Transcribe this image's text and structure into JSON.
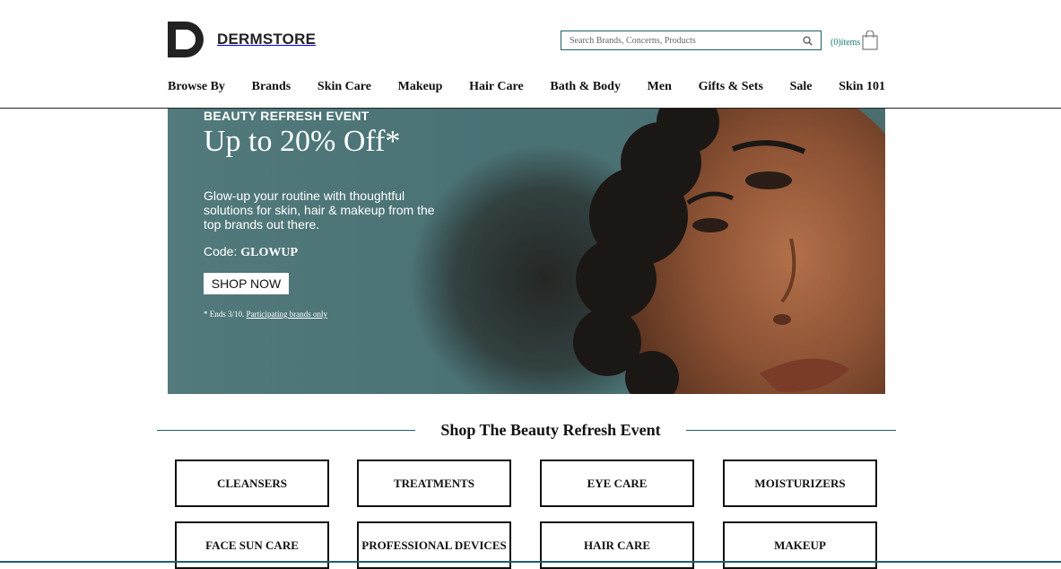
{
  "brand": {
    "name": "DERMSTORE"
  },
  "search": {
    "placeholder": "Search Brands, Concerns, Products",
    "icon": "search-icon"
  },
  "cart": {
    "count_label": "(0)items",
    "icon": "shopping-bag-icon"
  },
  "nav": {
    "items": [
      {
        "label": "Browse By"
      },
      {
        "label": "Brands"
      },
      {
        "label": "Skin Care"
      },
      {
        "label": "Makeup"
      },
      {
        "label": "Hair Care"
      },
      {
        "label": "Bath & Body"
      },
      {
        "label": "Men"
      },
      {
        "label": "Gifts & Sets"
      },
      {
        "label": "Sale"
      },
      {
        "label": "Skin 101"
      }
    ]
  },
  "hero": {
    "eyebrow": "BEAUTY REFRESH EVENT",
    "headline": "Up to 20% Off*",
    "body": "Glow-up your routine with thoughtful solutions for skin, hair & makeup from the top brands out there.",
    "code_label": "Code:",
    "code_value": "GLOWUP",
    "cta": "SHOP NOW",
    "fine_print": "* Ends 3/10.",
    "fine_link": "Participating brands only"
  },
  "section": {
    "title": "Shop The Beauty Refresh Event"
  },
  "categories": [
    {
      "label": "CLEANSERS"
    },
    {
      "label": "TREATMENTS"
    },
    {
      "label": "EYE CARE"
    },
    {
      "label": "MOISTURIZERS"
    },
    {
      "label": "FACE SUN CARE"
    },
    {
      "label": "PROFESSIONAL DEVICES"
    },
    {
      "label": "HAIR CARE"
    },
    {
      "label": "MAKEUP"
    }
  ],
  "colors": {
    "accent": "#1f5f6b",
    "hero_bg": "#4d7477",
    "cart_text": "#1a7a7a"
  }
}
